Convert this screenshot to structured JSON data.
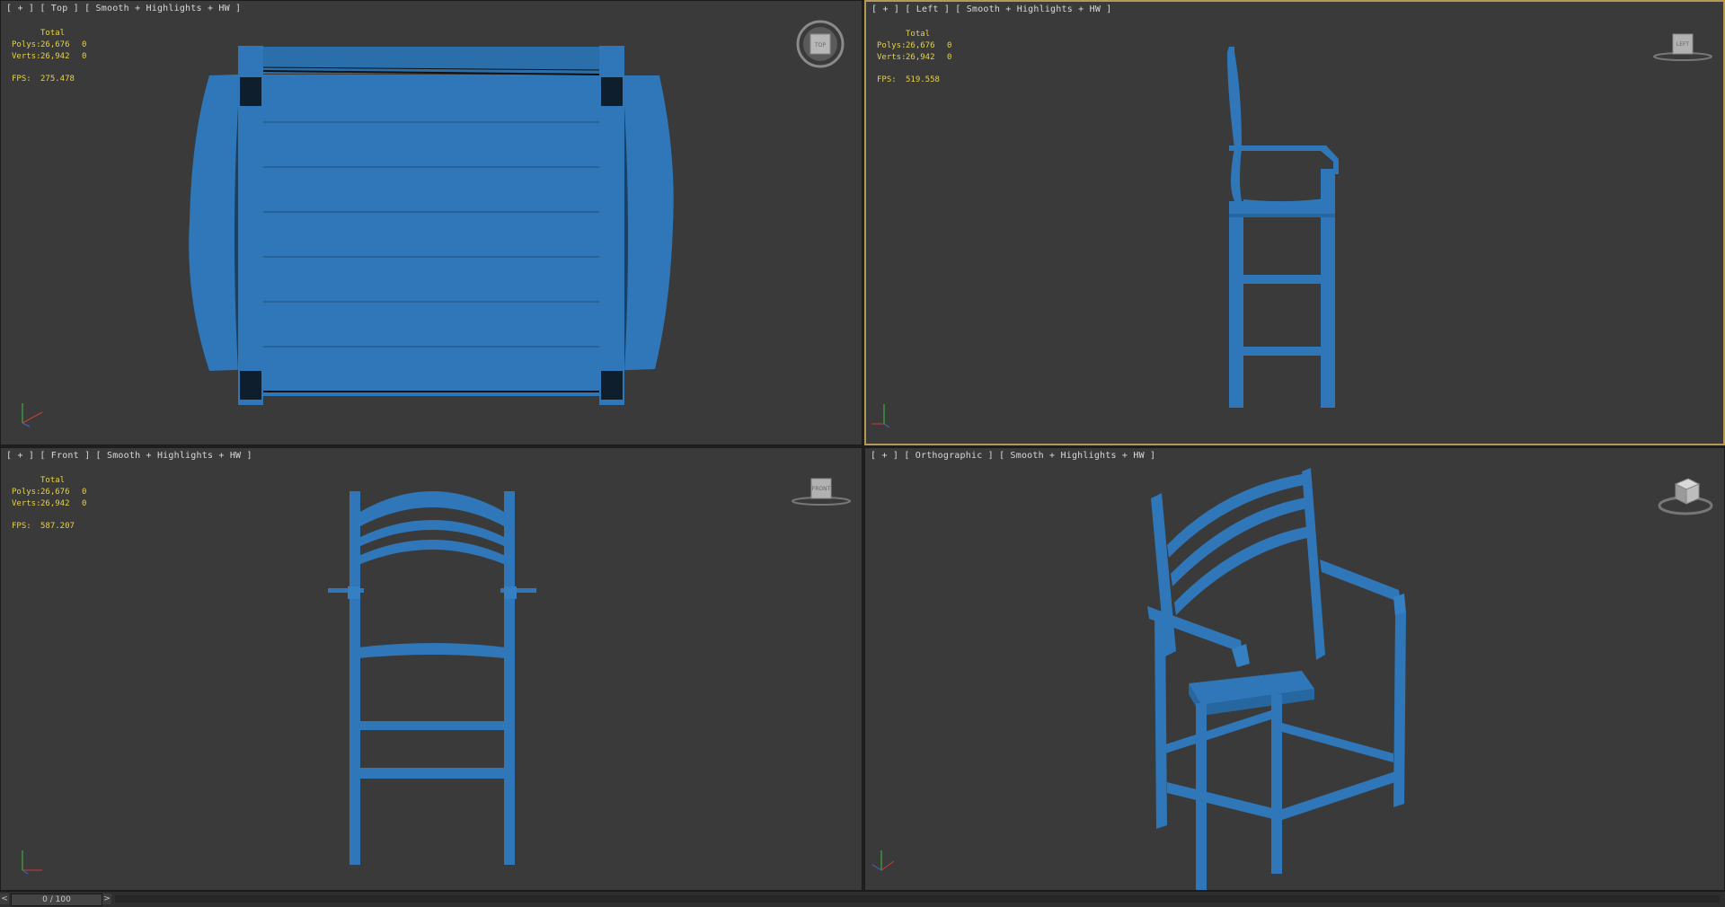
{
  "viewports": [
    {
      "label": "[ + ] [ Top ] [ Smooth + Highlights + HW ]",
      "stats": {
        "total": "Total",
        "polys_label": "Polys:",
        "polys": "26,676",
        "polys_sel": "0",
        "verts_label": "Verts:",
        "verts": "26,942",
        "verts_sel": "0",
        "fps_label": "FPS:",
        "fps": "275.478"
      },
      "viewcube": "TOP"
    },
    {
      "label": "[ + ] [ Left ] [ Smooth + Highlights + HW ]",
      "stats": {
        "total": "Total",
        "polys_label": "Polys:",
        "polys": "26,676",
        "polys_sel": "0",
        "verts_label": "Verts:",
        "verts": "26,942",
        "verts_sel": "0",
        "fps_label": "FPS:",
        "fps": "519.558"
      },
      "viewcube": "LEFT"
    },
    {
      "label": "[ + ] [ Front ] [ Smooth + Highlights + HW ]",
      "stats": {
        "total": "Total",
        "polys_label": "Polys:",
        "polys": "26,676",
        "polys_sel": "0",
        "verts_label": "Verts:",
        "verts": "26,942",
        "verts_sel": "0",
        "fps_label": "FPS:",
        "fps": "587.207"
      },
      "viewcube": "FRONT"
    },
    {
      "label": "[ + ] [ Orthographic ] [ Smooth + Highlights + HW ]",
      "viewcube": ""
    }
  ],
  "timeline": {
    "prev": "<",
    "next": ">",
    "frame": "0 / 100"
  },
  "colors": {
    "model": "#2f77b8",
    "viewport_bg": "#3a3a3a",
    "stats_text": "#e7d24a",
    "active_border": "#b59a57"
  }
}
